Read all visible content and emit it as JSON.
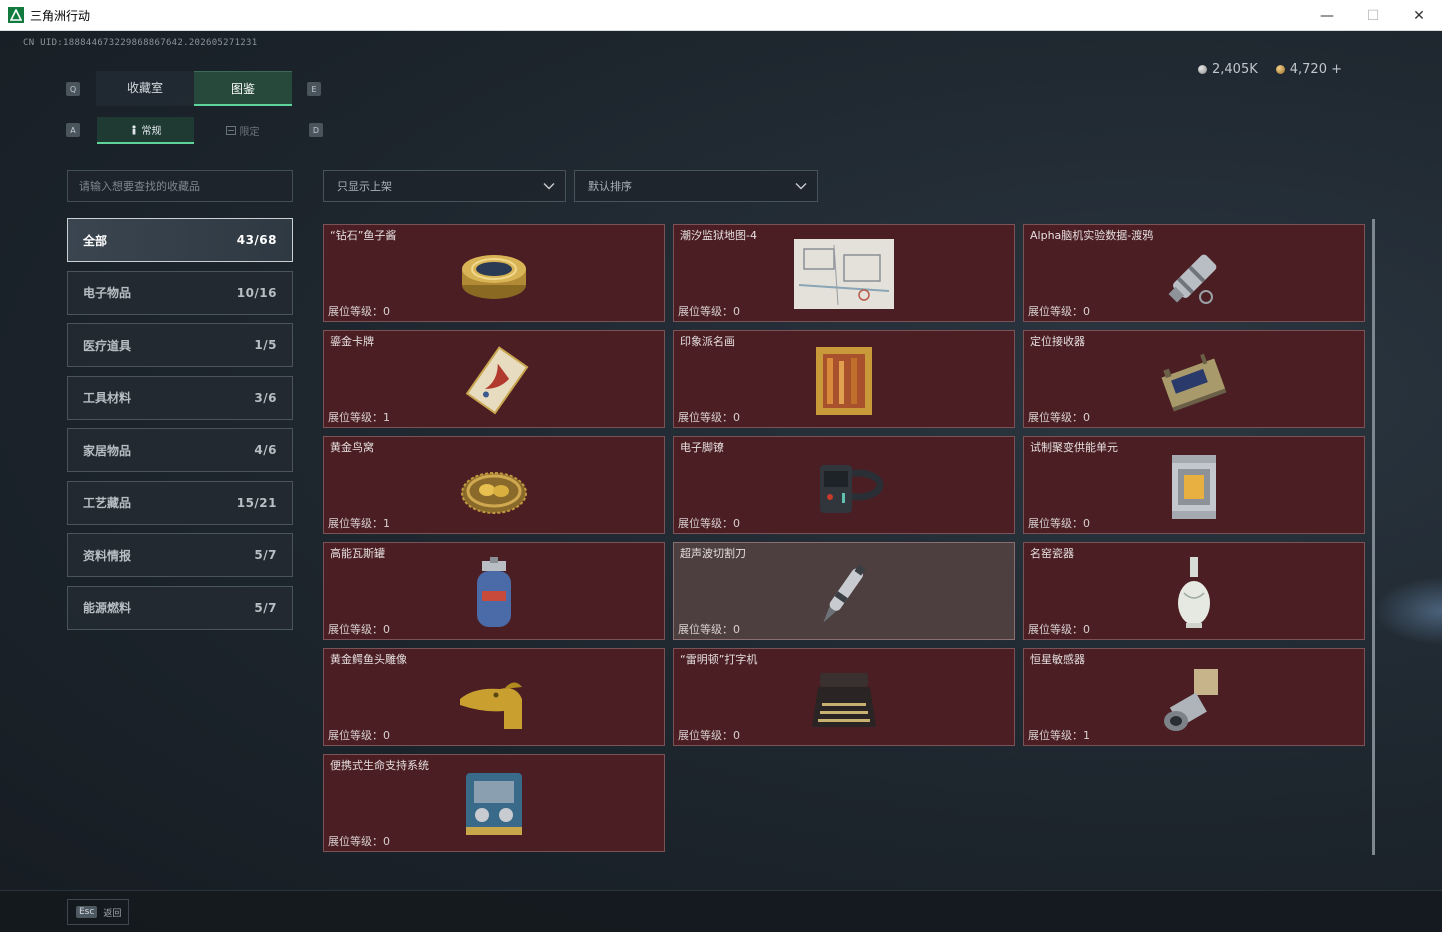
{
  "window": {
    "title": "三角洲行动",
    "controls": {
      "minimize": "—",
      "maximize": "☐",
      "close": "✕"
    }
  },
  "header": {
    "uid": "CN UID:188844673229868867642.202605271231",
    "currency": {
      "silver": "2,405K",
      "gold": "4,720 +"
    },
    "key_hints": {
      "tab_left": "Q",
      "tab_right": "E",
      "subtab_left": "A",
      "subtab_right": "D"
    }
  },
  "tabs": [
    {
      "label": "收藏室",
      "active": false
    },
    {
      "label": "图鉴",
      "active": true
    }
  ],
  "subtabs": [
    {
      "label": "常规",
      "icon": "figure-icon",
      "active": true
    },
    {
      "label": "限定",
      "icon": "box-icon",
      "active": false
    }
  ],
  "search": {
    "placeholder": "请输入想要查找的收藏品"
  },
  "filters": {
    "shelf": {
      "value": "只显示上架"
    },
    "sort": {
      "value": "默认排序"
    }
  },
  "categories": [
    {
      "label": "全部",
      "count": "43/68",
      "active": true
    },
    {
      "label": "电子物品",
      "count": "10/16"
    },
    {
      "label": "医疗道具",
      "count": "1/5"
    },
    {
      "label": "工具材料",
      "count": "3/6"
    },
    {
      "label": "家居物品",
      "count": "4/6"
    },
    {
      "label": "工艺藏品",
      "count": "15/21"
    },
    {
      "label": "资料情报",
      "count": "5/7"
    },
    {
      "label": "能源燃料",
      "count": "5/7"
    }
  ],
  "level_label": "展位等级：",
  "items": [
    {
      "name": "“钻石”鱼子酱",
      "level": "0",
      "icon": "caviar-tin-icon"
    },
    {
      "name": "潮汐监狱地图-4",
      "level": "0",
      "icon": "map-icon"
    },
    {
      "name": "Alpha脑机实验数据-渡鸦",
      "level": "0",
      "icon": "data-capsule-icon"
    },
    {
      "name": "鎏金卡牌",
      "level": "1",
      "icon": "gilded-card-icon"
    },
    {
      "name": "印象派名画",
      "level": "0",
      "icon": "painting-icon"
    },
    {
      "name": "定位接收器",
      "level": "0",
      "icon": "receiver-icon"
    },
    {
      "name": "黄金鸟窝",
      "level": "1",
      "icon": "golden-nest-icon"
    },
    {
      "name": "电子脚镣",
      "level": "0",
      "icon": "ankle-monitor-icon"
    },
    {
      "name": "试制聚变供能单元",
      "level": "0",
      "icon": "fusion-unit-icon"
    },
    {
      "name": "高能瓦斯罐",
      "level": "0",
      "icon": "gas-tank-icon"
    },
    {
      "name": "超声波切割刀",
      "level": "0",
      "icon": "ultrasonic-knife-icon"
    },
    {
      "name": "名窑瓷器",
      "level": "0",
      "icon": "porcelain-vase-icon"
    },
    {
      "name": "黄金鳄鱼头雕像",
      "level": "0",
      "icon": "crocodile-statue-icon"
    },
    {
      "name": "“雷明顿”打字机",
      "level": "0",
      "icon": "typewriter-icon"
    },
    {
      "name": "恒星敏感器",
      "level": "1",
      "icon": "star-sensor-icon"
    },
    {
      "name": "便携式生命支持系统",
      "level": "0",
      "icon": "life-support-icon"
    }
  ],
  "footer": {
    "esc_key": "Esc",
    "back_label": "返回"
  },
  "colors": {
    "accent": "#5fd39a",
    "card_bg": "#4a1e22",
    "card_border": "#7a5356"
  }
}
